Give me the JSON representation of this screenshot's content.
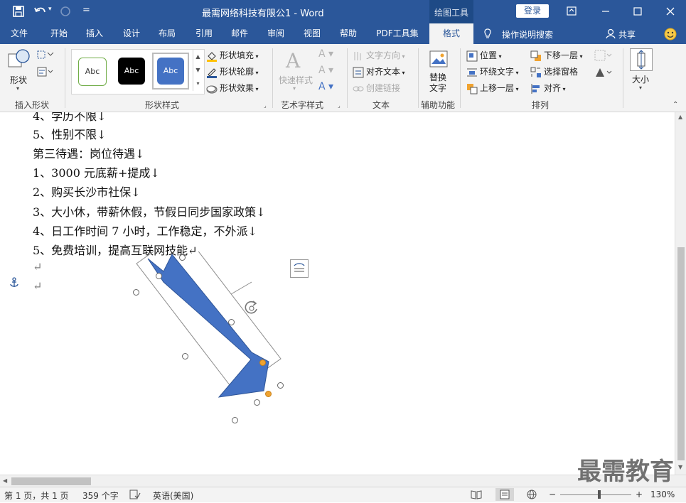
{
  "titlebar": {
    "doc_title": "最需网络科技有限公1  -  Word",
    "context_tab": "绘图工具",
    "login": "登录",
    "qat_dropdown": "="
  },
  "tabs": [
    "文件",
    "开始",
    "插入",
    "设计",
    "布局",
    "引用",
    "邮件",
    "审阅",
    "视图",
    "帮助",
    "PDF工具集",
    "格式"
  ],
  "active_tab": "格式",
  "tell_me": "操作说明搜索",
  "share": "共享",
  "ribbon": {
    "insert_shapes": {
      "shapes_label": "形状",
      "group": "插入形状"
    },
    "shape_styles": {
      "styles": [
        "Abc",
        "Abc",
        "Abc"
      ],
      "fill": "形状填充",
      "outline": "形状轮廓",
      "effects": "形状效果",
      "group": "形状样式"
    },
    "wordart": {
      "quick_styles": "快速样式",
      "group": "艺术字样式"
    },
    "text": {
      "direction": "文字方向",
      "align": "对齐文本",
      "link": "创建链接",
      "group": "文本"
    },
    "accessibility": {
      "alt_text_line1": "替换",
      "alt_text_line2": "文字",
      "group": "辅助功能"
    },
    "arrange": {
      "position": "位置",
      "wrap": "环绕文字",
      "forward": "上移一层",
      "backward": "下移一层",
      "pane": "选择窗格",
      "align": "对齐",
      "group": "排列"
    },
    "size": {
      "label": "大小"
    }
  },
  "document": {
    "lines": [
      "4、学历不限↓",
      "5、性别不限↓",
      "第三待遇：岗位待遇↓",
      "1、3000 元底薪+提成↓",
      "2、购买长沙市社保↓",
      "3、大小休，带薪休假，节假日同步国家政策↓",
      "4、日工作时间 7 小时，工作稳定，不外派↓",
      "5、免费培训，提高互联网技能↵"
    ],
    "empty_marks": [
      "↵",
      "↵"
    ],
    "anchor_icon": "anchor-icon",
    "layout_options_icon": "layout-options-icon"
  },
  "status": {
    "page": "第 1 页，共 1 页",
    "words": "359 个字",
    "lang": "英语(美国)",
    "zoom": "130%",
    "minus": "−",
    "plus": "+"
  },
  "watermark": "最需教育",
  "colors": {
    "brand": "#2b579a",
    "arrow_fill": "#4472c4",
    "handle_yellow": "#f0a330"
  }
}
